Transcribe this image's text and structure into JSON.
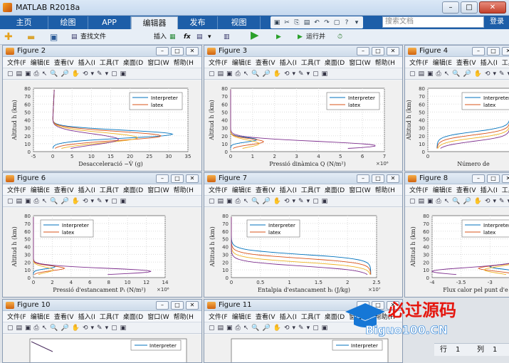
{
  "app": {
    "title": "MATLAB R2018a",
    "win_controls": [
      "–",
      "□",
      "✕"
    ]
  },
  "tabs": [
    {
      "label": "主页"
    },
    {
      "label": "绘图"
    },
    {
      "label": "APP"
    },
    {
      "label": "编辑器"
    },
    {
      "label": "发布"
    },
    {
      "label": "视图"
    }
  ],
  "search": {
    "placeholder": "搜索文档"
  },
  "login": "登录",
  "ribbon": {
    "find_files": "查找文件",
    "insert": "插入",
    "fx": "fx",
    "run_advance": "运行并"
  },
  "menus": [
    "文件(F",
    "编辑(E",
    "查看(V",
    "插入(I",
    "工具(T",
    "桌面(D",
    "窗口(W",
    "帮助(H"
  ],
  "toolbar_glyphs": [
    "▢",
    "▤",
    "▣",
    "⎙",
    "↖",
    "🔍",
    "🔎",
    "✋",
    "⟲",
    "▾",
    "✎",
    "▾",
    "▢",
    "▣"
  ],
  "legend": [
    "Interpreter",
    "latex"
  ],
  "colors": {
    "series": [
      "#0072bd",
      "#d95319",
      "#edb120",
      "#7e2f8e"
    ]
  },
  "figures": [
    {
      "title": "Figure 2",
      "xlabel": "Desacceleració −V̇ (g)",
      "ylabel": "Altitud h (km)",
      "xticks": [
        "-5",
        "0",
        "5",
        "10",
        "15",
        "20",
        "25",
        "30",
        "35"
      ],
      "yticks": [
        "0",
        "10",
        "20",
        "30",
        "40",
        "50",
        "60",
        "70",
        "80"
      ],
      "multiplier": ""
    },
    {
      "title": "Figure 3",
      "xlabel": "Pressió dinàmica Q (N/m²)",
      "ylabel": "Altitud h (km)",
      "xticks": [
        "0",
        "1",
        "2",
        "3",
        "4",
        "5",
        "6",
        "7"
      ],
      "yticks": [
        "0",
        "10",
        "20",
        "30",
        "40",
        "50",
        "60",
        "70",
        "80"
      ],
      "multiplier": "×10⁶"
    },
    {
      "title": "Figure 4",
      "xlabel": "Número de",
      "ylabel": "Altitud h (km)",
      "xticks": [
        "0"
      ],
      "yticks": [
        "0",
        "10",
        "20",
        "30",
        "40",
        "50",
        "60",
        "70",
        "80"
      ],
      "multiplier": ""
    },
    {
      "title": "Figure 6",
      "xlabel": "Pressió d'estancament Pₜ (N/m²)",
      "ylabel": "Altitud h (km)",
      "xticks": [
        "0",
        "2",
        "4",
        "6",
        "8",
        "10",
        "12",
        "14"
      ],
      "yticks": [
        "0",
        "10",
        "20",
        "30",
        "40",
        "50",
        "60",
        "70",
        "80"
      ],
      "multiplier": "×10⁶"
    },
    {
      "title": "Figure 7",
      "xlabel": "Entalpia d'estancament hₜ (J/kg)",
      "ylabel": "Altitud h (km)",
      "xticks": [
        "0",
        "0.5",
        "1",
        "1.5",
        "2",
        "2.5"
      ],
      "yticks": [
        "0",
        "10",
        "20",
        "30",
        "40",
        "50",
        "60",
        "70",
        "80"
      ],
      "multiplier": "×10⁷"
    },
    {
      "title": "Figure 8",
      "xlabel": "Flux calor pel punt d'e",
      "ylabel": "Altitud h (km)",
      "xticks": [
        "-4",
        "-3.5",
        "-3",
        "-2.5"
      ],
      "yticks": [
        "0",
        "10",
        "20",
        "30",
        "40",
        "50",
        "60",
        "70",
        "80"
      ],
      "multiplier": ""
    },
    {
      "title": "Figure 10"
    },
    {
      "title": "Figure 11"
    }
  ],
  "status": {
    "row_label": "行",
    "row": "1",
    "col_label": "列",
    "col": "1"
  },
  "watermark": {
    "line1": "必过源码",
    "line2": "Biguo100.CN"
  }
}
